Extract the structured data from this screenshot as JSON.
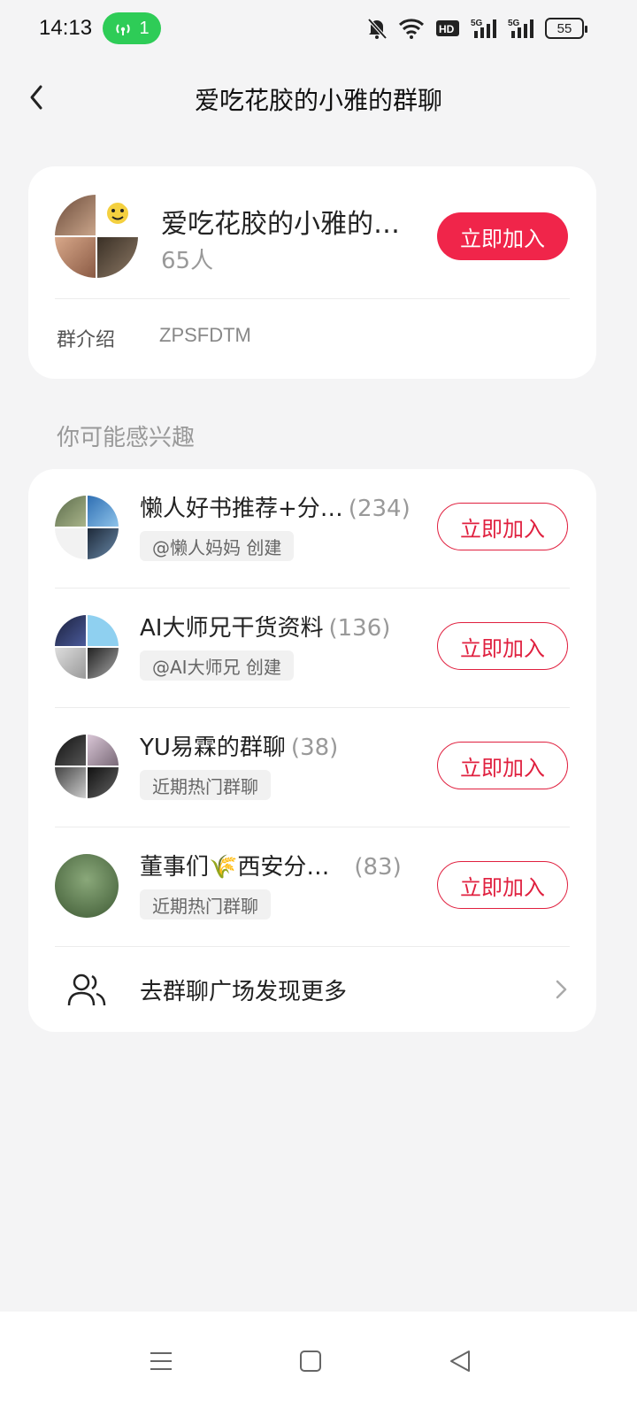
{
  "status_bar": {
    "time": "14:13",
    "hotspot_count": "1",
    "battery": "55"
  },
  "header": {
    "title": "爱吃花胶的小雅的群聊"
  },
  "group": {
    "name": "爱吃花胶的小雅的…",
    "member_count": "65人",
    "join_label": "立即加入",
    "intro_label": "群介绍",
    "intro_value": "ZPSFDTM"
  },
  "recommend": {
    "section_title": "你可能感兴趣",
    "items": [
      {
        "name": "懒人好书推荐+分…",
        "count": "(234)",
        "tag": "@懒人妈妈 创建",
        "join_label": "立即加入"
      },
      {
        "name": "AI大师兄干货资料",
        "count": "(136)",
        "tag": "@AI大师兄 创建",
        "join_label": "立即加入"
      },
      {
        "name": "YU易霖的群聊",
        "count": "(38)",
        "tag": "近期热门群聊",
        "join_label": "立即加入"
      },
      {
        "name": "董事们🌾西安分…",
        "count": "(83)",
        "tag": "近期热门群聊",
        "join_label": "立即加入"
      }
    ],
    "more_label": "去群聊广场发现更多"
  },
  "colors": {
    "accent": "#f0254a",
    "background": "#f4f4f5",
    "hotspot": "#2ecc57"
  },
  "icons": [
    "hotspot-icon",
    "mute-icon",
    "wifi-icon",
    "hd-icon",
    "signal-5g-icon",
    "battery-icon",
    "back-icon",
    "group-users-icon",
    "chevron-right-icon",
    "menu-nav-icon",
    "home-nav-icon",
    "back-nav-icon"
  ]
}
